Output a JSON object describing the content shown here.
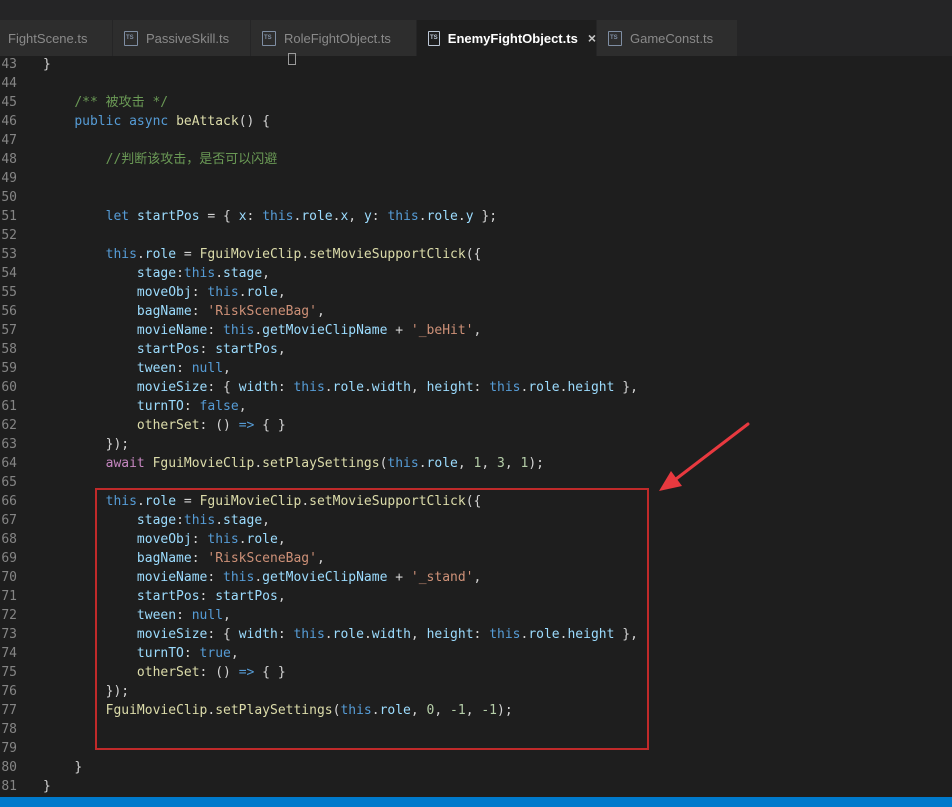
{
  "tabs": [
    {
      "label": "FightScene.ts",
      "active": false,
      "icon": "typescript-file-icon"
    },
    {
      "label": "PassiveSkill.ts",
      "active": false,
      "icon": "typescript-file-icon"
    },
    {
      "label": "RoleFightObject.ts",
      "active": false,
      "icon": "typescript-file-icon"
    },
    {
      "label": "EnemyFightObject.ts",
      "active": true,
      "icon": "typescript-file-icon"
    },
    {
      "label": "GameConst.ts",
      "active": false,
      "icon": "typescript-file-icon"
    }
  ],
  "close_glyph": "×",
  "colors": {
    "background": "#1e1e1e",
    "tab_inactive": "#2d2d2d",
    "keyword": "#569cd6",
    "property": "#9cdcfe",
    "function": "#dcdcaa",
    "string": "#ce9178",
    "number": "#b5cea8",
    "comment": "#6a9955",
    "highlight_box": "#c02a2a",
    "annotation_arrow": "#e8393f",
    "status_bar": "#007acc"
  },
  "lines": [
    {
      "n": "43",
      "tokens": [
        {
          "t": "}",
          "c": ""
        }
      ]
    },
    {
      "n": "44",
      "tokens": []
    },
    {
      "n": "45",
      "tokens": [
        {
          "t": "    ",
          "c": ""
        },
        {
          "t": "/** 被攻击 */",
          "c": "c"
        }
      ]
    },
    {
      "n": "46",
      "tokens": [
        {
          "t": "    ",
          "c": ""
        },
        {
          "t": "public",
          "c": "k"
        },
        {
          "t": " ",
          "c": ""
        },
        {
          "t": "async",
          "c": "k"
        },
        {
          "t": " ",
          "c": ""
        },
        {
          "t": "beAttack",
          "c": "f"
        },
        {
          "t": "() {",
          "c": ""
        }
      ]
    },
    {
      "n": "47",
      "tokens": []
    },
    {
      "n": "48",
      "tokens": [
        {
          "t": "        ",
          "c": ""
        },
        {
          "t": "//判断该攻击，是否可以闪避",
          "c": "c"
        }
      ]
    },
    {
      "n": "49",
      "tokens": []
    },
    {
      "n": "50",
      "tokens": []
    },
    {
      "n": "51",
      "tokens": [
        {
          "t": "        ",
          "c": ""
        },
        {
          "t": "let",
          "c": "k"
        },
        {
          "t": " ",
          "c": ""
        },
        {
          "t": "startPos",
          "c": "p"
        },
        {
          "t": " = { ",
          "c": ""
        },
        {
          "t": "x",
          "c": "p"
        },
        {
          "t": ": ",
          "c": ""
        },
        {
          "t": "this",
          "c": "t"
        },
        {
          "t": ".",
          "c": ""
        },
        {
          "t": "role",
          "c": "p"
        },
        {
          "t": ".",
          "c": ""
        },
        {
          "t": "x",
          "c": "p"
        },
        {
          "t": ", ",
          "c": ""
        },
        {
          "t": "y",
          "c": "p"
        },
        {
          "t": ": ",
          "c": ""
        },
        {
          "t": "this",
          "c": "t"
        },
        {
          "t": ".",
          "c": ""
        },
        {
          "t": "role",
          "c": "p"
        },
        {
          "t": ".",
          "c": ""
        },
        {
          "t": "y",
          "c": "p"
        },
        {
          "t": " };",
          "c": ""
        }
      ]
    },
    {
      "n": "52",
      "tokens": []
    },
    {
      "n": "53",
      "tokens": [
        {
          "t": "        ",
          "c": ""
        },
        {
          "t": "this",
          "c": "t"
        },
        {
          "t": ".",
          "c": ""
        },
        {
          "t": "role",
          "c": "p"
        },
        {
          "t": " = ",
          "c": ""
        },
        {
          "t": "FguiMovieClip",
          "c": "cls"
        },
        {
          "t": ".",
          "c": ""
        },
        {
          "t": "setMovieSupportClick",
          "c": "f"
        },
        {
          "t": "({",
          "c": ""
        }
      ]
    },
    {
      "n": "54",
      "tokens": [
        {
          "t": "            ",
          "c": ""
        },
        {
          "t": "stage",
          "c": "p"
        },
        {
          "t": ":",
          "c": ""
        },
        {
          "t": "this",
          "c": "t"
        },
        {
          "t": ".",
          "c": ""
        },
        {
          "t": "stage",
          "c": "p"
        },
        {
          "t": ",",
          "c": ""
        }
      ]
    },
    {
      "n": "55",
      "tokens": [
        {
          "t": "            ",
          "c": ""
        },
        {
          "t": "moveObj",
          "c": "p"
        },
        {
          "t": ": ",
          "c": ""
        },
        {
          "t": "this",
          "c": "t"
        },
        {
          "t": ".",
          "c": ""
        },
        {
          "t": "role",
          "c": "p"
        },
        {
          "t": ",",
          "c": ""
        }
      ]
    },
    {
      "n": "56",
      "tokens": [
        {
          "t": "            ",
          "c": ""
        },
        {
          "t": "bagName",
          "c": "p"
        },
        {
          "t": ": ",
          "c": ""
        },
        {
          "t": "'RiskSceneBag'",
          "c": "s"
        },
        {
          "t": ",",
          "c": ""
        }
      ]
    },
    {
      "n": "57",
      "tokens": [
        {
          "t": "            ",
          "c": ""
        },
        {
          "t": "movieName",
          "c": "p"
        },
        {
          "t": ": ",
          "c": ""
        },
        {
          "t": "this",
          "c": "t"
        },
        {
          "t": ".",
          "c": ""
        },
        {
          "t": "getMovieClipName",
          "c": "p"
        },
        {
          "t": " + ",
          "c": ""
        },
        {
          "t": "'_beHit'",
          "c": "s"
        },
        {
          "t": ",",
          "c": ""
        }
      ]
    },
    {
      "n": "58",
      "tokens": [
        {
          "t": "            ",
          "c": ""
        },
        {
          "t": "startPos",
          "c": "p"
        },
        {
          "t": ": ",
          "c": ""
        },
        {
          "t": "startPos",
          "c": "p"
        },
        {
          "t": ",",
          "c": ""
        }
      ]
    },
    {
      "n": "59",
      "tokens": [
        {
          "t": "            ",
          "c": ""
        },
        {
          "t": "tween",
          "c": "p"
        },
        {
          "t": ": ",
          "c": ""
        },
        {
          "t": "null",
          "c": "k"
        },
        {
          "t": ",",
          "c": ""
        }
      ]
    },
    {
      "n": "60",
      "tokens": [
        {
          "t": "            ",
          "c": ""
        },
        {
          "t": "movieSize",
          "c": "p"
        },
        {
          "t": ": { ",
          "c": ""
        },
        {
          "t": "width",
          "c": "p"
        },
        {
          "t": ": ",
          "c": ""
        },
        {
          "t": "this",
          "c": "t"
        },
        {
          "t": ".",
          "c": ""
        },
        {
          "t": "role",
          "c": "p"
        },
        {
          "t": ".",
          "c": ""
        },
        {
          "t": "width",
          "c": "p"
        },
        {
          "t": ", ",
          "c": ""
        },
        {
          "t": "height",
          "c": "p"
        },
        {
          "t": ": ",
          "c": ""
        },
        {
          "t": "this",
          "c": "t"
        },
        {
          "t": ".",
          "c": ""
        },
        {
          "t": "role",
          "c": "p"
        },
        {
          "t": ".",
          "c": ""
        },
        {
          "t": "height",
          "c": "p"
        },
        {
          "t": " },",
          "c": ""
        }
      ]
    },
    {
      "n": "61",
      "tokens": [
        {
          "t": "            ",
          "c": ""
        },
        {
          "t": "turnTO",
          "c": "p"
        },
        {
          "t": ": ",
          "c": ""
        },
        {
          "t": "false",
          "c": "k"
        },
        {
          "t": ",",
          "c": ""
        }
      ]
    },
    {
      "n": "62",
      "tokens": [
        {
          "t": "            ",
          "c": ""
        },
        {
          "t": "otherSet",
          "c": "f"
        },
        {
          "t": ": () ",
          "c": ""
        },
        {
          "t": "=>",
          "c": "k"
        },
        {
          "t": " { }",
          "c": ""
        }
      ]
    },
    {
      "n": "63",
      "tokens": [
        {
          "t": "        ",
          "c": ""
        },
        {
          "t": "});",
          "c": ""
        }
      ]
    },
    {
      "n": "64",
      "tokens": [
        {
          "t": "        ",
          "c": ""
        },
        {
          "t": "await",
          "c": "a"
        },
        {
          "t": " ",
          "c": ""
        },
        {
          "t": "FguiMovieClip",
          "c": "cls"
        },
        {
          "t": ".",
          "c": ""
        },
        {
          "t": "setPlaySettings",
          "c": "f"
        },
        {
          "t": "(",
          "c": ""
        },
        {
          "t": "this",
          "c": "t"
        },
        {
          "t": ".",
          "c": ""
        },
        {
          "t": "role",
          "c": "p"
        },
        {
          "t": ", ",
          "c": ""
        },
        {
          "t": "1",
          "c": "n"
        },
        {
          "t": ", ",
          "c": ""
        },
        {
          "t": "3",
          "c": "n"
        },
        {
          "t": ", ",
          "c": ""
        },
        {
          "t": "1",
          "c": "n"
        },
        {
          "t": ");",
          "c": ""
        }
      ]
    },
    {
      "n": "65",
      "tokens": []
    },
    {
      "n": "66",
      "tokens": [
        {
          "t": "        ",
          "c": ""
        },
        {
          "t": "this",
          "c": "t"
        },
        {
          "t": ".",
          "c": ""
        },
        {
          "t": "role",
          "c": "p"
        },
        {
          "t": " = ",
          "c": ""
        },
        {
          "t": "FguiMovieClip",
          "c": "cls"
        },
        {
          "t": ".",
          "c": ""
        },
        {
          "t": "setMovieSupportClick",
          "c": "f"
        },
        {
          "t": "({",
          "c": ""
        }
      ]
    },
    {
      "n": "67",
      "tokens": [
        {
          "t": "            ",
          "c": ""
        },
        {
          "t": "stage",
          "c": "p"
        },
        {
          "t": ":",
          "c": ""
        },
        {
          "t": "this",
          "c": "t"
        },
        {
          "t": ".",
          "c": ""
        },
        {
          "t": "stage",
          "c": "p"
        },
        {
          "t": ",",
          "c": ""
        }
      ]
    },
    {
      "n": "68",
      "tokens": [
        {
          "t": "            ",
          "c": ""
        },
        {
          "t": "moveObj",
          "c": "p"
        },
        {
          "t": ": ",
          "c": ""
        },
        {
          "t": "this",
          "c": "t"
        },
        {
          "t": ".",
          "c": ""
        },
        {
          "t": "role",
          "c": "p"
        },
        {
          "t": ",",
          "c": ""
        }
      ]
    },
    {
      "n": "69",
      "tokens": [
        {
          "t": "            ",
          "c": ""
        },
        {
          "t": "bagName",
          "c": "p"
        },
        {
          "t": ": ",
          "c": ""
        },
        {
          "t": "'RiskSceneBag'",
          "c": "s"
        },
        {
          "t": ",",
          "c": ""
        }
      ]
    },
    {
      "n": "70",
      "tokens": [
        {
          "t": "            ",
          "c": ""
        },
        {
          "t": "movieName",
          "c": "p"
        },
        {
          "t": ": ",
          "c": ""
        },
        {
          "t": "this",
          "c": "t"
        },
        {
          "t": ".",
          "c": ""
        },
        {
          "t": "getMovieClipName",
          "c": "p"
        },
        {
          "t": " + ",
          "c": ""
        },
        {
          "t": "'_stand'",
          "c": "s"
        },
        {
          "t": ",",
          "c": ""
        }
      ]
    },
    {
      "n": "71",
      "tokens": [
        {
          "t": "            ",
          "c": ""
        },
        {
          "t": "startPos",
          "c": "p"
        },
        {
          "t": ": ",
          "c": ""
        },
        {
          "t": "startPos",
          "c": "p"
        },
        {
          "t": ",",
          "c": ""
        }
      ]
    },
    {
      "n": "72",
      "tokens": [
        {
          "t": "            ",
          "c": ""
        },
        {
          "t": "tween",
          "c": "p"
        },
        {
          "t": ": ",
          "c": ""
        },
        {
          "t": "null",
          "c": "k"
        },
        {
          "t": ",",
          "c": ""
        }
      ]
    },
    {
      "n": "73",
      "tokens": [
        {
          "t": "            ",
          "c": ""
        },
        {
          "t": "movieSize",
          "c": "p"
        },
        {
          "t": ": { ",
          "c": ""
        },
        {
          "t": "width",
          "c": "p"
        },
        {
          "t": ": ",
          "c": ""
        },
        {
          "t": "this",
          "c": "t"
        },
        {
          "t": ".",
          "c": ""
        },
        {
          "t": "role",
          "c": "p"
        },
        {
          "t": ".",
          "c": ""
        },
        {
          "t": "width",
          "c": "p"
        },
        {
          "t": ", ",
          "c": ""
        },
        {
          "t": "height",
          "c": "p"
        },
        {
          "t": ": ",
          "c": ""
        },
        {
          "t": "this",
          "c": "t"
        },
        {
          "t": ".",
          "c": ""
        },
        {
          "t": "role",
          "c": "p"
        },
        {
          "t": ".",
          "c": ""
        },
        {
          "t": "height",
          "c": "p"
        },
        {
          "t": " },",
          "c": ""
        }
      ]
    },
    {
      "n": "74",
      "tokens": [
        {
          "t": "            ",
          "c": ""
        },
        {
          "t": "turnTO",
          "c": "p"
        },
        {
          "t": ": ",
          "c": ""
        },
        {
          "t": "true",
          "c": "k"
        },
        {
          "t": ",",
          "c": ""
        }
      ]
    },
    {
      "n": "75",
      "tokens": [
        {
          "t": "            ",
          "c": ""
        },
        {
          "t": "otherSet",
          "c": "f"
        },
        {
          "t": ": () ",
          "c": ""
        },
        {
          "t": "=>",
          "c": "k"
        },
        {
          "t": " { }",
          "c": ""
        }
      ]
    },
    {
      "n": "76",
      "tokens": [
        {
          "t": "        ",
          "c": ""
        },
        {
          "t": "});",
          "c": ""
        }
      ]
    },
    {
      "n": "77",
      "tokens": [
        {
          "t": "        ",
          "c": ""
        },
        {
          "t": "FguiMovieClip",
          "c": "cls"
        },
        {
          "t": ".",
          "c": ""
        },
        {
          "t": "setPlaySettings",
          "c": "f"
        },
        {
          "t": "(",
          "c": ""
        },
        {
          "t": "this",
          "c": "t"
        },
        {
          "t": ".",
          "c": ""
        },
        {
          "t": "role",
          "c": "p"
        },
        {
          "t": ", ",
          "c": ""
        },
        {
          "t": "0",
          "c": "n"
        },
        {
          "t": ", ",
          "c": ""
        },
        {
          "t": "-1",
          "c": "n"
        },
        {
          "t": ", ",
          "c": ""
        },
        {
          "t": "-1",
          "c": "n"
        },
        {
          "t": ");",
          "c": ""
        }
      ]
    },
    {
      "n": "78",
      "tokens": []
    },
    {
      "n": "79",
      "tokens": []
    },
    {
      "n": "80",
      "tokens": [
        {
          "t": "    ",
          "c": ""
        },
        {
          "t": "}",
          "c": ""
        }
      ]
    },
    {
      "n": "81",
      "tokens": [
        {
          "t": "}",
          "c": ""
        }
      ]
    }
  ]
}
